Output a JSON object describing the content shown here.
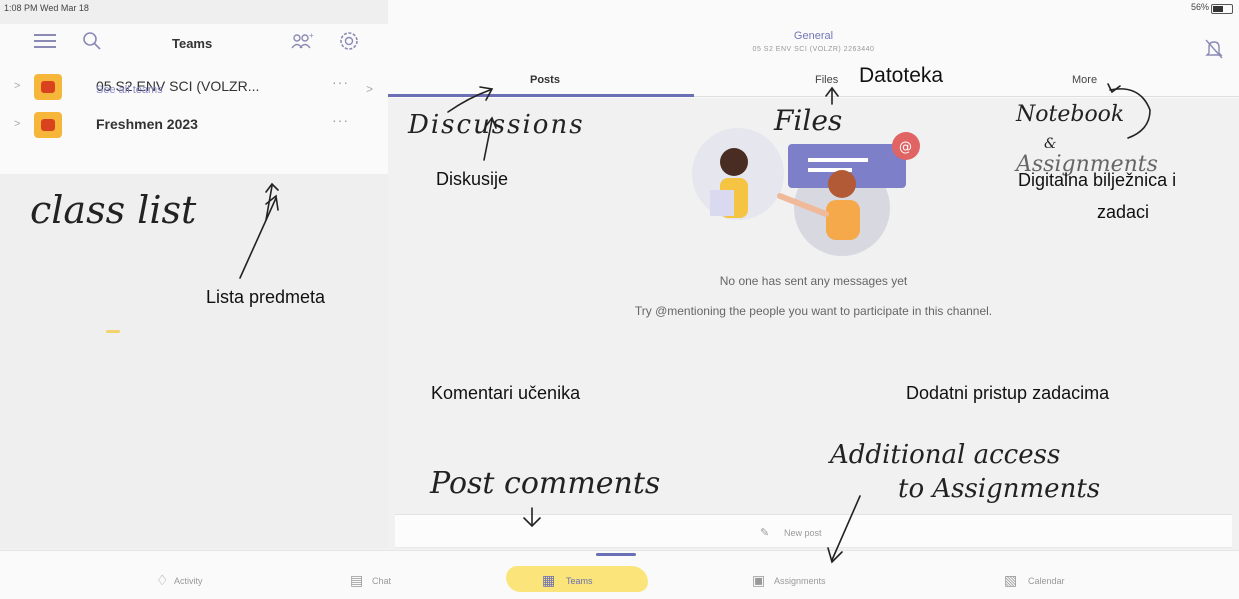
{
  "status_bar": {
    "time_date": "1:08 PM  Wed Mar 18",
    "battery": "56%"
  },
  "sidebar": {
    "title": "Teams",
    "teams": [
      {
        "name": "05 S2 ENV SCI (VOLZR...",
        "more": "···"
      },
      {
        "name": "Freshmen 2023",
        "more": "···"
      }
    ],
    "see_all": "See all teams",
    "see_all_chevron": ">"
  },
  "channel": {
    "title": "General",
    "subtitle": "05 S2 ENV SCI (VOLZR) 2263440"
  },
  "tabs": [
    {
      "label": "Posts"
    },
    {
      "label": "Files"
    },
    {
      "label": "More"
    }
  ],
  "empty_state": {
    "line1": "No one has sent any messages yet",
    "line2": "Try @mentioning the people you want to participate in this channel."
  },
  "new_post": {
    "label": "New post"
  },
  "bottom_tabs": [
    {
      "label": "Activity"
    },
    {
      "label": "Chat"
    },
    {
      "label": "Teams"
    },
    {
      "label": "Assignments"
    },
    {
      "label": "Calendar"
    }
  ],
  "annotations": {
    "handwritten": {
      "discussions": "Discussions",
      "files": "Files",
      "notebook": "Notebook",
      "and": "&",
      "assignments": "Assignments",
      "class_list": "class list",
      "post_comments": "Post comments",
      "additional_1": "Additional access",
      "additional_2": "to Assignments"
    },
    "croatian": {
      "datoteka": "Datoteka",
      "diskusije": "Diskusije",
      "biljeznica_1": "Digitalna bilježnica i",
      "biljeznica_2": "zadaci",
      "lista": "Lista predmeta",
      "komentari": "Komentari učenika",
      "dodatni": "Dodatni pristup zadacima"
    }
  },
  "colors": {
    "accent": "#6b6fb3",
    "team_avatar_bg": "#f6b63a",
    "team_avatar_fg": "#d9421e",
    "highlight": "#fbe57a"
  },
  "icons": [
    "hamburger-icon",
    "search-icon",
    "join-team-icon",
    "gear-icon",
    "bell-off-icon",
    "activity-icon",
    "chat-icon",
    "teams-icon",
    "assignments-icon",
    "calendar-icon",
    "compose-icon"
  ]
}
